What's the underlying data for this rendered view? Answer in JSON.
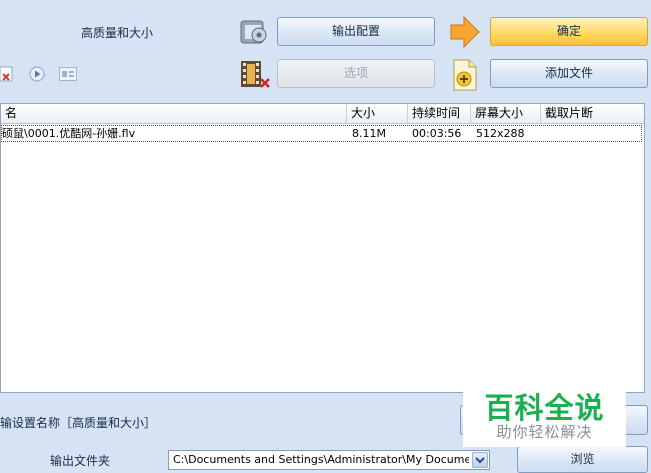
{
  "top": {
    "profile_label": "高质量和大小",
    "output_config_button": "输出配置",
    "options_button": "选项",
    "confirm_button": "确定",
    "add_file_button": "添加文件"
  },
  "file_list": {
    "columns": [
      "名",
      "大小",
      "持续时间",
      "屏幕大小",
      "截取片断"
    ],
    "rows": [
      {
        "name": "硕鼠\\0001.优酷网-孙姗.flv",
        "size": "8.11M",
        "duration": "00:03:56",
        "resolution": "512x288",
        "clip": ""
      }
    ]
  },
  "bottom": {
    "profile_name_label": "输设置名称［高质量和大小］",
    "output_folder_label": "输出文件夹",
    "output_path": "C:\\Documents and Settings\\Administrator\\My Documents\\FFO",
    "browse_button": "浏览"
  },
  "watermark": {
    "title": "百科全说",
    "subtitle": "助你轻松解决"
  },
  "colors": {
    "background": "#d5e3f5",
    "confirm_button": "#ffd65e",
    "watermark_green": "#1ab04f"
  }
}
